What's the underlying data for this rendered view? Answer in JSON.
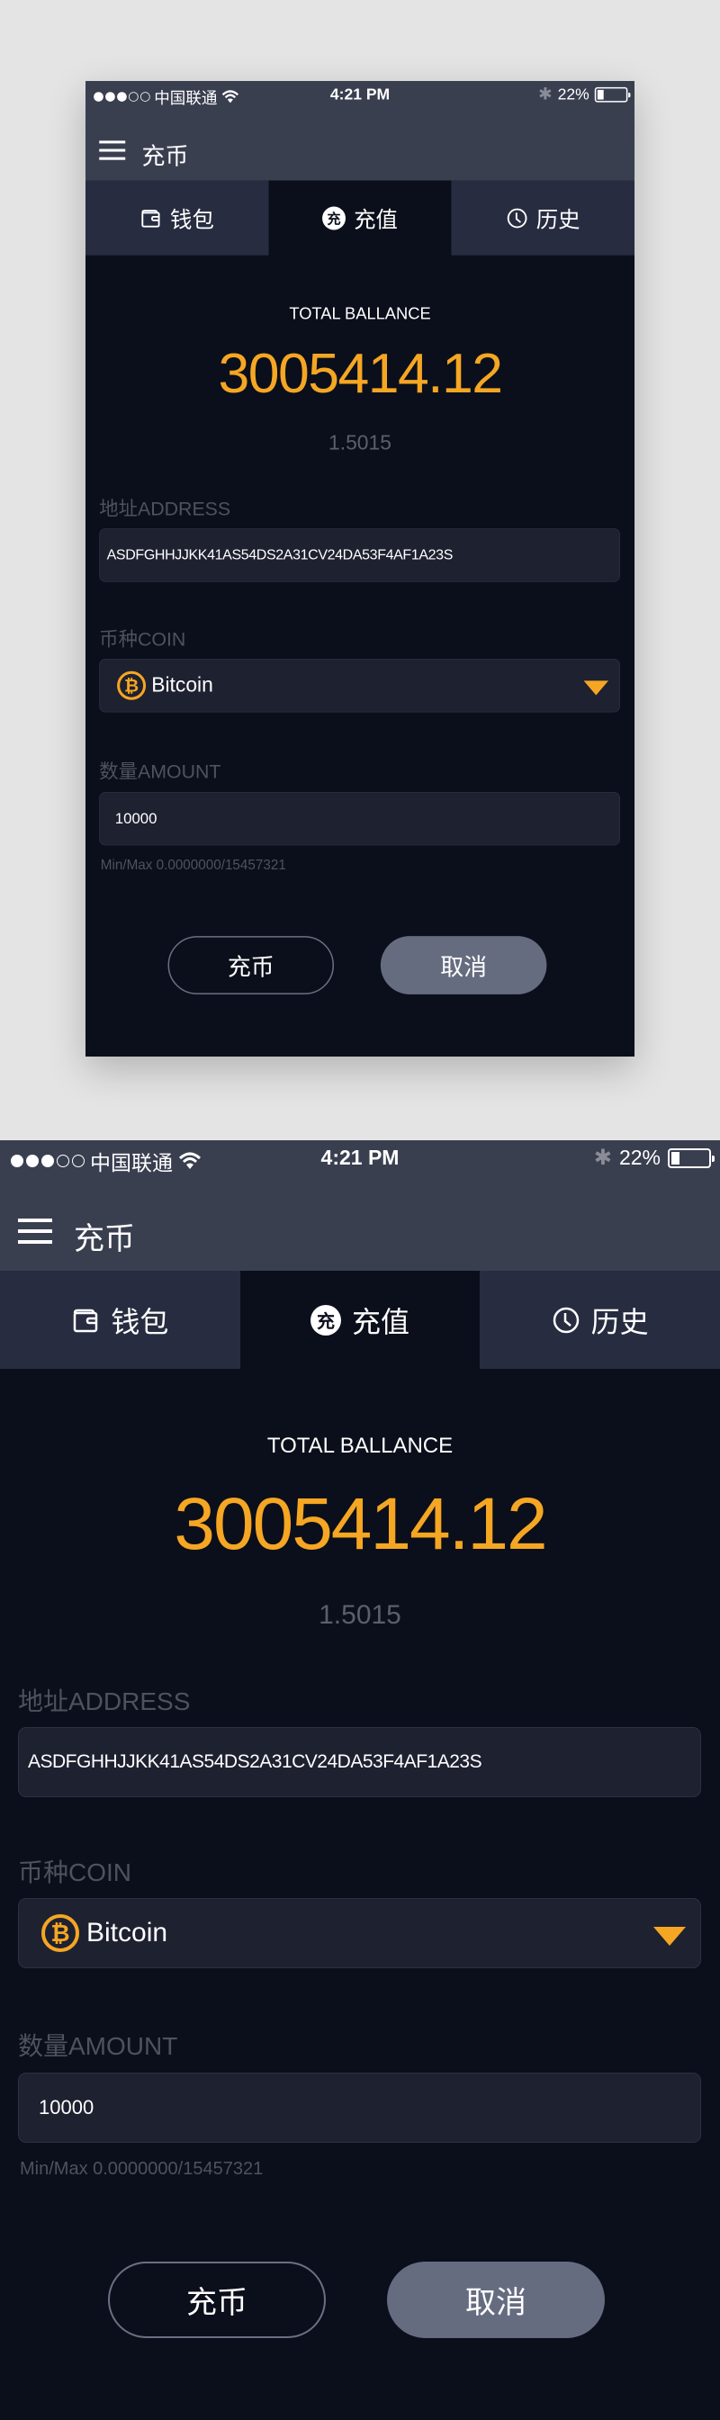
{
  "status_bar": {
    "signal_filled": 3,
    "signal_total": 5,
    "carrier": "中国联通",
    "time": "4:21 PM",
    "battery_text": "22%",
    "battery_level": 0.22
  },
  "header": {
    "menu_icon": "hamburger-menu-icon",
    "title": "充币"
  },
  "tabs": [
    {
      "label": "钱包",
      "icon": "wallet-icon",
      "active": false
    },
    {
      "label": "充值",
      "icon": "charge-badge-icon",
      "icon_glyph": "充",
      "active": true
    },
    {
      "label": "历史",
      "icon": "clock-icon",
      "active": false
    }
  ],
  "balance": {
    "label": "TOTAL BALLANCE",
    "value": "3005414.12",
    "sub_value": "1.5015"
  },
  "form": {
    "address": {
      "label": "地址ADDRESS",
      "value": "ASDFGHHJJKK41AS54DS2A31CV24DA53F4AF1A23S"
    },
    "coin": {
      "label": "币种COIN",
      "selected": "Bitcoin",
      "icon": "bitcoin-icon",
      "icon_glyph": "₿"
    },
    "amount": {
      "label": "数量AMOUNT",
      "value": "10000",
      "hint": "Min/Max  0.0000000/15457321"
    }
  },
  "actions": {
    "submit_label": "充币",
    "cancel_label": "取消"
  },
  "colors": {
    "accent": "#f5a623",
    "header_bg": "#3a3f50",
    "tab_bg": "#272c40",
    "content_bg": "#0b0f1b",
    "input_bg": "#1e2130",
    "cancel_bg": "#666c80",
    "page_bg": "#e4e4e4"
  }
}
